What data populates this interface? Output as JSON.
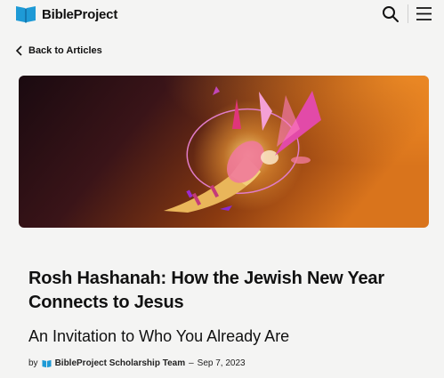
{
  "header": {
    "brand": "BibleProject",
    "icons": {
      "logo": "book-logo-icon",
      "search": "search-icon",
      "menu": "hamburger-menu-icon"
    }
  },
  "nav": {
    "back_label": "Back to Articles"
  },
  "hero": {
    "image": "shofar-illustration"
  },
  "article": {
    "title": "Rosh Hashanah: How the Jewish New Year Connects to Jesus",
    "subtitle": "An Invitation to Who You Already Are",
    "byline": {
      "by": "by",
      "author": "BibleProject Scholarship Team",
      "separator": "–",
      "date": "Sep 7, 2023"
    }
  },
  "colors": {
    "brand_blue": "#1e9ad6",
    "background": "#f4f4f3",
    "text": "#111111"
  }
}
